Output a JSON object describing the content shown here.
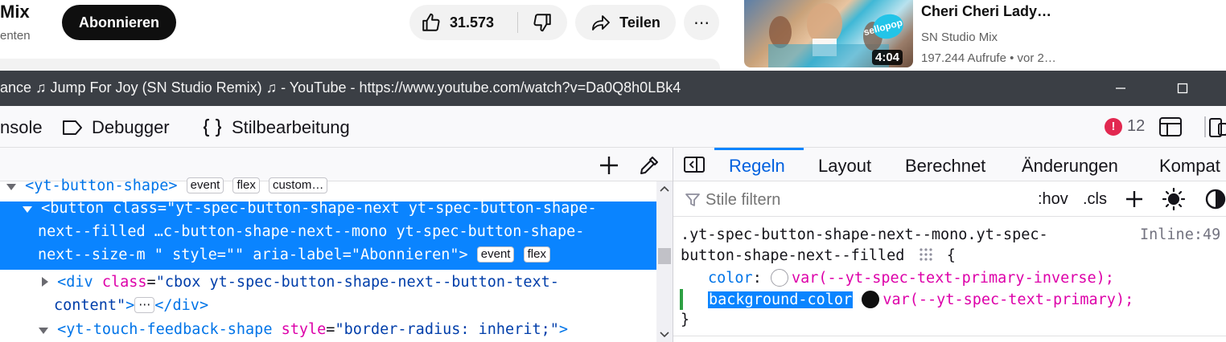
{
  "youtube": {
    "channel_name": "Mix",
    "channel_subs": "enten",
    "subscribe_label": "Abonnieren",
    "like_count": "31.573",
    "share_label": "Teilen",
    "more_label": "⋯",
    "recommended": {
      "duration": "4:04",
      "title": "Cheri Cheri Lady…",
      "channel": "SN Studio Mix",
      "meta": "197.244 Aufrufe • vor 2…",
      "logo_text": "sellopop"
    }
  },
  "window": {
    "title": "ance ♫ Jump For Joy (SN Studio Remix) ♫ - YouTube - https://www.youtube.com/watch?v=Da0Q8h0LBk4"
  },
  "devtools": {
    "tabs": {
      "console": "nsole",
      "debugger": "Debugger",
      "style_editor": "Stilbearbeitung"
    },
    "error_count": "12",
    "error_icon": "!"
  },
  "inspector": {
    "rows": {
      "r0": {
        "tag": "<yt-button-shape>",
        "badges": [
          "event",
          "flex",
          "custom…"
        ]
      },
      "r1_line1": "<button class=\"yt-spec-button-shape-next yt-spec-button-shape-",
      "r1_line2": "next--filled …c-button-shape-next--mono yt-spec-button-shape-",
      "r1_line3": "next--size-m \" style=\"\" aria-label=\"Abonnieren\">",
      "r1_badges": [
        "event",
        "flex"
      ],
      "r2_open": "<div",
      "r2_attr": "class",
      "r2_val_line1": "\"cbox yt-spec-button-shape-next--button-text-",
      "r2_val_line2": "content\"",
      "r2_close_a": ">",
      "r2_ellipsis": "⋯",
      "r2_close_b": "</div>",
      "r3_open": "<yt-touch-feedback-shape",
      "r3_attr": "style",
      "r3_val": "\"border-radius: inherit;\"",
      "r3_close": ">"
    }
  },
  "rules": {
    "tabs": [
      "Regeln",
      "Layout",
      "Berechnet",
      "Änderungen",
      "Kompat"
    ],
    "active_tab": "Regeln",
    "filter_placeholder": "Stile filtern",
    "hov_label": ":hov",
    "cls_label": ".cls",
    "selector_line1": ".yt-spec-button-shape-next--mono.yt-spec-",
    "selector_line2": "button-shape-next--filled",
    "brace_open": "{",
    "source": "Inline:49",
    "declarations": [
      {
        "name": "color",
        "value": "var(--yt-spec-text-primary-inverse);",
        "swatch": "#ffffff"
      },
      {
        "name": "background-color",
        "value": "var(--yt-spec-text-primary);",
        "swatch": "#0f0f0f"
      }
    ],
    "brace_close": "}"
  }
}
